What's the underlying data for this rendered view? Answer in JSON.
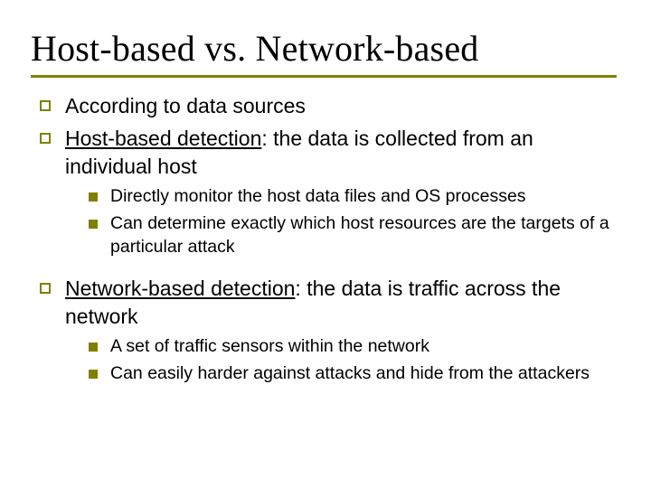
{
  "title": "Host-based vs. Network-based",
  "b1": {
    "a": "According to data sources",
    "b_u": "Host-based detection",
    "b_rest": ": the data is collected from an individual host",
    "c_u": "Network-based detection",
    "c_rest": ": the data is traffic across the network"
  },
  "b2": {
    "b1": "Directly monitor the host data files and OS processes",
    "b2": "Can determine exactly which host resources are the targets of a particular attack",
    "c1": "A set of traffic sensors within the network",
    "c2": "Can easily harder against attacks and hide from the attackers"
  }
}
